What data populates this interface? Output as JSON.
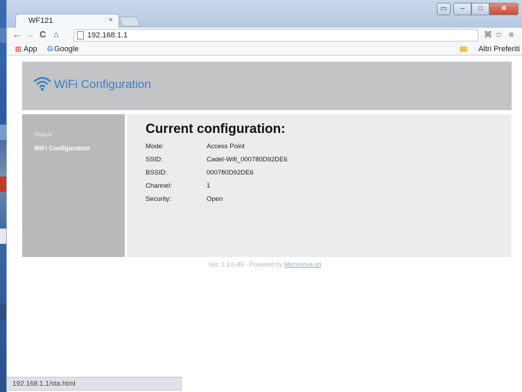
{
  "browser": {
    "tab_title": "WF121",
    "tab_close": "×",
    "address": "192.168.1.1",
    "bookmarks": {
      "apps": "App",
      "google": "Google",
      "other": "Altri Preferiti"
    },
    "status_url": "192.168.1.1/sta.html"
  },
  "page": {
    "app_title": "WiFi Configuration",
    "sidebar": [
      {
        "label": "Status"
      },
      {
        "label": "WiFi Configuration"
      }
    ],
    "main": {
      "title": "Current configuration:",
      "rows": [
        {
          "label": "Mode:",
          "value": "Access Point"
        },
        {
          "label": "SSID:",
          "value": "Cadel-Wifi_000780D92DE6"
        },
        {
          "label": "BSSID:",
          "value": "000780D92DE6"
        },
        {
          "label": "Channel:",
          "value": "1"
        },
        {
          "label": "Security:",
          "value": "Open"
        }
      ]
    },
    "footer": {
      "prefix": "Ver. 1.3.0-85 - Powered by ",
      "link": "Micronova srl"
    }
  },
  "colors": {
    "accent": "#3a7fc1",
    "header_bg": "#c2c4c6",
    "sidebar_bg": "#b7b9bb",
    "content_bg": "#ececec"
  },
  "icons": [
    "wifi-logo-icon",
    "back-icon",
    "forward-icon",
    "reload-icon",
    "home-icon",
    "page-icon",
    "translate-icon",
    "star-icon",
    "menu-icon",
    "apps-icon",
    "google-icon",
    "folder-icon"
  ]
}
